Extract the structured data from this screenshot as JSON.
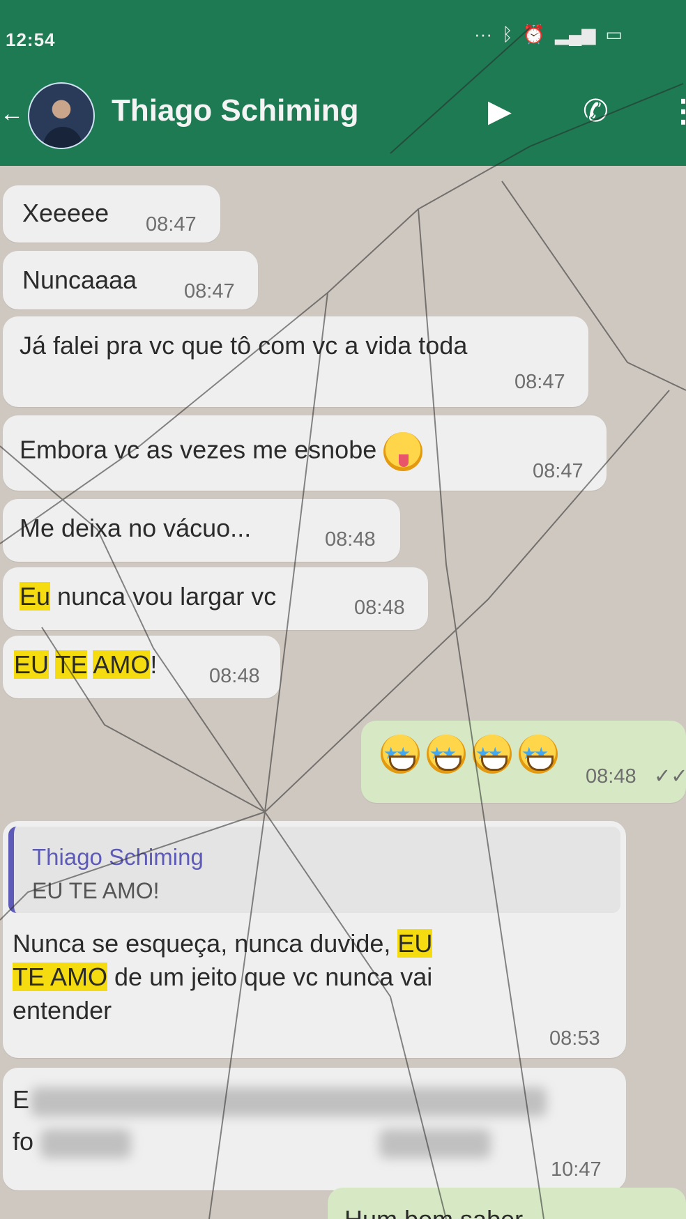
{
  "status": {
    "time": "12:54",
    "icons": [
      "signal-dots-icon",
      "bluetooth-icon",
      "alarm-icon",
      "signal-icon",
      "battery-icon"
    ]
  },
  "header": {
    "contact_name": "Thiago Schiming",
    "icons": [
      "back-arrow-icon",
      "video-call-icon",
      "voice-call-icon",
      "more-menu-icon"
    ]
  },
  "colors": {
    "header_bg": "#1d7a53",
    "incoming_bubble": "#efefef",
    "outgoing_bubble": "#d6e9c4",
    "highlight": "#f5dc10",
    "quote_accent": "#5e5ab8"
  },
  "messages": [
    {
      "text": "Xeeeee",
      "time": "08:47"
    },
    {
      "text": "Nuncaaaa",
      "time": "08:47"
    },
    {
      "text": "Já falei pra vc que tô com vc a vida toda",
      "time": "08:47"
    },
    {
      "text": "Embora vc as vezes me esnobe",
      "time": "08:47",
      "emoji": "tongue-face-emoji"
    },
    {
      "text": "Me deixa no vácuo...",
      "time": "08:48"
    },
    {
      "text_highlight": "Eu",
      "text_rest": " nunca vou largar vc",
      "time": "08:48"
    },
    {
      "hl1": "EU",
      "hl2": "TE",
      "hl3": "AMO",
      "rest": "!",
      "time": "08:48"
    },
    {
      "outgoing": true,
      "emojis": "star-struck-emoji x4",
      "time": "08:48",
      "status": "read-ticks-icon"
    },
    {
      "reply_author": "Thiago Schiming",
      "reply_text": "EU TE AMO!",
      "line1": "Nunca se esqueça, nunca duvide, ",
      "line1_hl": "EU",
      "line2_hl": "TE AMO",
      "line2": " de um jeito que vc nunca vai",
      "line3": "entender",
      "time": "08:53"
    },
    {
      "visible_start_1": "E",
      "visible_start_2": "fo",
      "time": "10:47"
    },
    {
      "outgoing": true,
      "partial_text": "Hum bom saber"
    }
  ]
}
